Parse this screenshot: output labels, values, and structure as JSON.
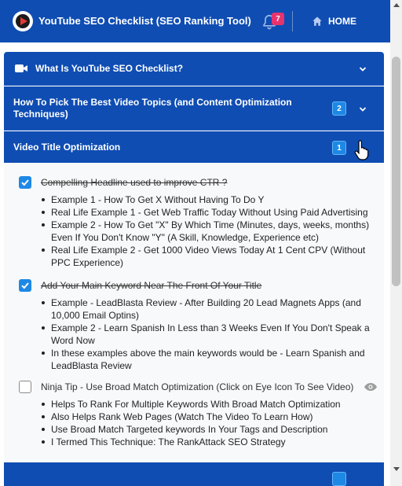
{
  "header": {
    "app_title": "YouTube SEO Checklist (SEO Ranking Tool)",
    "notification_count": "7",
    "home_label": "HOME",
    "logo_icon": "play-logo-icon",
    "bell_icon": "bell-icon",
    "home_icon": "home-icon",
    "bg_color": "#0f4db3"
  },
  "accordion": [
    {
      "title": "What Is YouTube SEO Checklist?",
      "icon": "video-camera-icon",
      "count": ""
    },
    {
      "title": "How To Pick The Best Video Topics (and Content Optimization Techniques)",
      "count": "2"
    },
    {
      "title": "Video Title Optimization",
      "count": "1",
      "expanded": true
    },
    {
      "title": "",
      "count": ""
    }
  ],
  "tasks": [
    {
      "title": "Compelling Headline used to improve CTR ?",
      "checked": true,
      "examples": [
        "Example 1 - How To Get X Without Having To Do Y",
        "Real Life Example 1 - Get Web Traffic Today Without Using Paid Advertising",
        "Example 2 - How To Get \"X\" By Which Time (Minutes, days, weeks, months) Even If You Don't Know \"Y\" (A Skill, Knowledge, Experience etc)",
        "Real Life Example 2 - Get 1000 Video Views Today At 1 Cent CPV (Without PPC Experience)"
      ]
    },
    {
      "title": "Add Your Main Keyword Near The Front Of Your Title",
      "checked": true,
      "examples": [
        "Example - LeadBlasta Review - After Building 20 Lead Magnets Apps (and 10,000 Email Optins)",
        "Example 2 - Learn Spanish In Less than 3 Weeks Even If You Don't Speak a Word Now",
        "In these examples above the main keywords would be - Learn Spanish and LeadBlasta Review"
      ]
    },
    {
      "title": "Ninja Tip - Use Broad Match Optimization (Click on Eye Icon To See Video)",
      "checked": false,
      "eye_icon": "eye-icon",
      "examples": [
        "Helps To Rank For Multiple Keywords With Broad Match Optimization",
        "Also Helps Rank Web Pages (Watch The Video To Learn How)",
        "Use Broad Match Targeted keywords In Your Tags and Description",
        "I Termed This Technique: The RankAttack SEO Strategy"
      ]
    }
  ]
}
